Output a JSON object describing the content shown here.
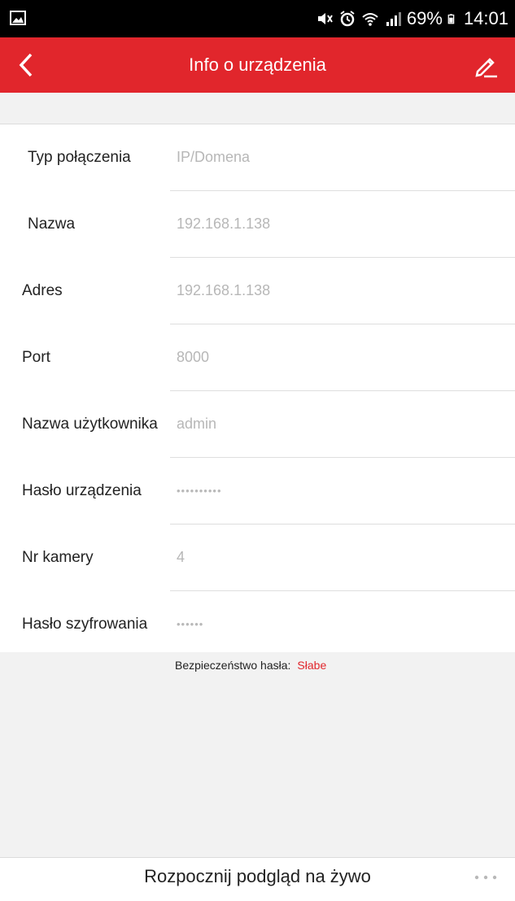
{
  "status_bar": {
    "battery_percent": "69%",
    "time": "14:01",
    "icons": [
      "gallery-icon",
      "mute-icon",
      "alarm-icon",
      "wifi-icon",
      "signal-icon",
      "battery-icon"
    ]
  },
  "header": {
    "title": "Info o urządzenia",
    "back_icon": "chevron-left-icon",
    "edit_icon": "pencil-icon"
  },
  "form": {
    "rows": [
      {
        "label": "Typ połączenia",
        "value": "IP/Domena"
      },
      {
        "label": "Nazwa",
        "value": "192.168.1.138"
      },
      {
        "label": "Adres",
        "value": "192.168.1.138"
      },
      {
        "label": "Port",
        "value": "8000"
      },
      {
        "label": "Nazwa użytkownika",
        "value": "admin"
      },
      {
        "label": "Hasło urządzenia",
        "value": "••••••••••"
      },
      {
        "label": "Nr kamery",
        "value": "4"
      },
      {
        "label": "Hasło szyfrowania",
        "value": "••••••"
      }
    ]
  },
  "password_strength": {
    "label": "Bezpieczeństwo hasła:",
    "value": "Słabe",
    "value_color": "#e1262c"
  },
  "bottom": {
    "start_live_label": "Rozpocznij podgląd na żywo",
    "more_icon": "more-dots-icon"
  },
  "colors": {
    "accent": "#e1262c",
    "background_gray": "#f2f2f2"
  }
}
